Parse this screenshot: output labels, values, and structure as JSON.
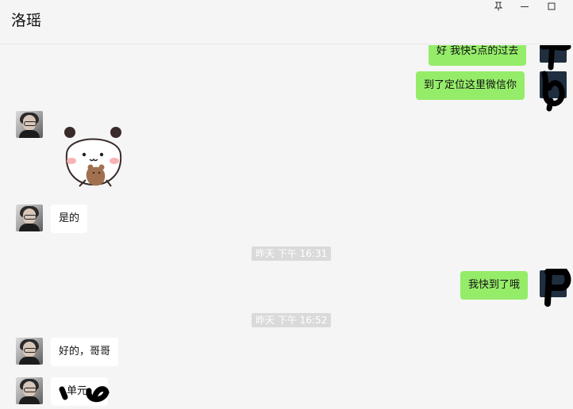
{
  "window": {
    "title": "洛瑶",
    "pin_icon": "pin-icon",
    "minimize_icon": "minimize-icon",
    "maximize_icon": "maximize-icon"
  },
  "messages": [
    {
      "side": "out",
      "text": "好 我快5点的过去",
      "partial": true
    },
    {
      "side": "out",
      "text": "到了定位这里微信你"
    },
    {
      "side": "in",
      "type": "sticker",
      "sticker": "panda-holding-bear-sticker"
    },
    {
      "side": "in",
      "text": "是的"
    },
    {
      "type": "time",
      "text": "昨天 下午 16:31"
    },
    {
      "side": "out",
      "text": "我快到了哦"
    },
    {
      "type": "time",
      "text": "昨天 下午 16:52"
    },
    {
      "side": "in",
      "text": "好的，哥哥"
    },
    {
      "side": "in",
      "text": "单元"
    }
  ]
}
